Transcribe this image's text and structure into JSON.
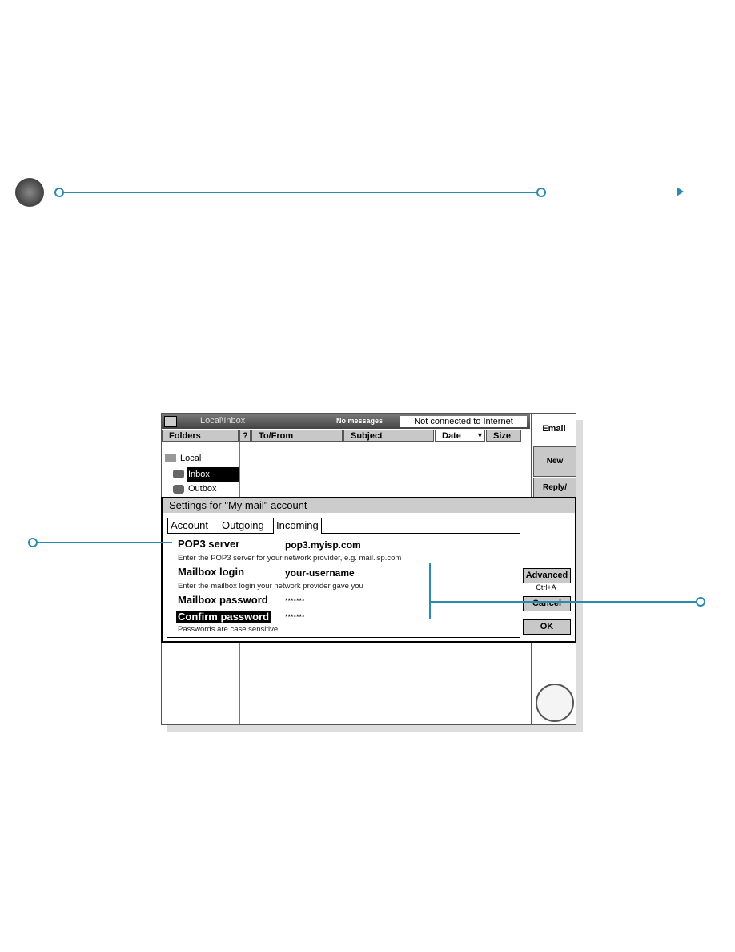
{
  "colors": {
    "callout": "#2a8ab0"
  },
  "app": {
    "path": "Local\\Inbox",
    "status": "No messages",
    "connection": "Not connected to Internet",
    "name": "Email"
  },
  "columns": [
    "Folders",
    "?",
    "To/From",
    "Subject",
    "Date",
    "Size"
  ],
  "folders": {
    "root": "Local",
    "items": [
      "Inbox",
      "Outbox"
    ],
    "selected": "Inbox"
  },
  "side_buttons": [
    "New",
    "Reply/ Fwd"
  ],
  "dialog": {
    "title": "Settings for \"My mail\" account",
    "tabs": [
      "Account",
      "Outgoing",
      "Incoming"
    ],
    "active_tab": "Incoming",
    "fields": [
      {
        "label": "POP3 server",
        "value": "pop3.myisp.com",
        "hint": "Enter the POP3 server for your network provider, e.g. mail.isp.com"
      },
      {
        "label": "Mailbox login",
        "value": "your-username",
        "hint": "Enter the mailbox login your network provider gave you"
      },
      {
        "label": "Mailbox password",
        "value": "*******",
        "hint": ""
      },
      {
        "label": "Confirm password",
        "value": "*******",
        "hint": "Passwords are case sensitive"
      }
    ],
    "buttons": {
      "advanced": "Advanced",
      "advanced_shortcut": "Ctrl+A",
      "cancel": "Cancel",
      "ok": "OK"
    }
  }
}
